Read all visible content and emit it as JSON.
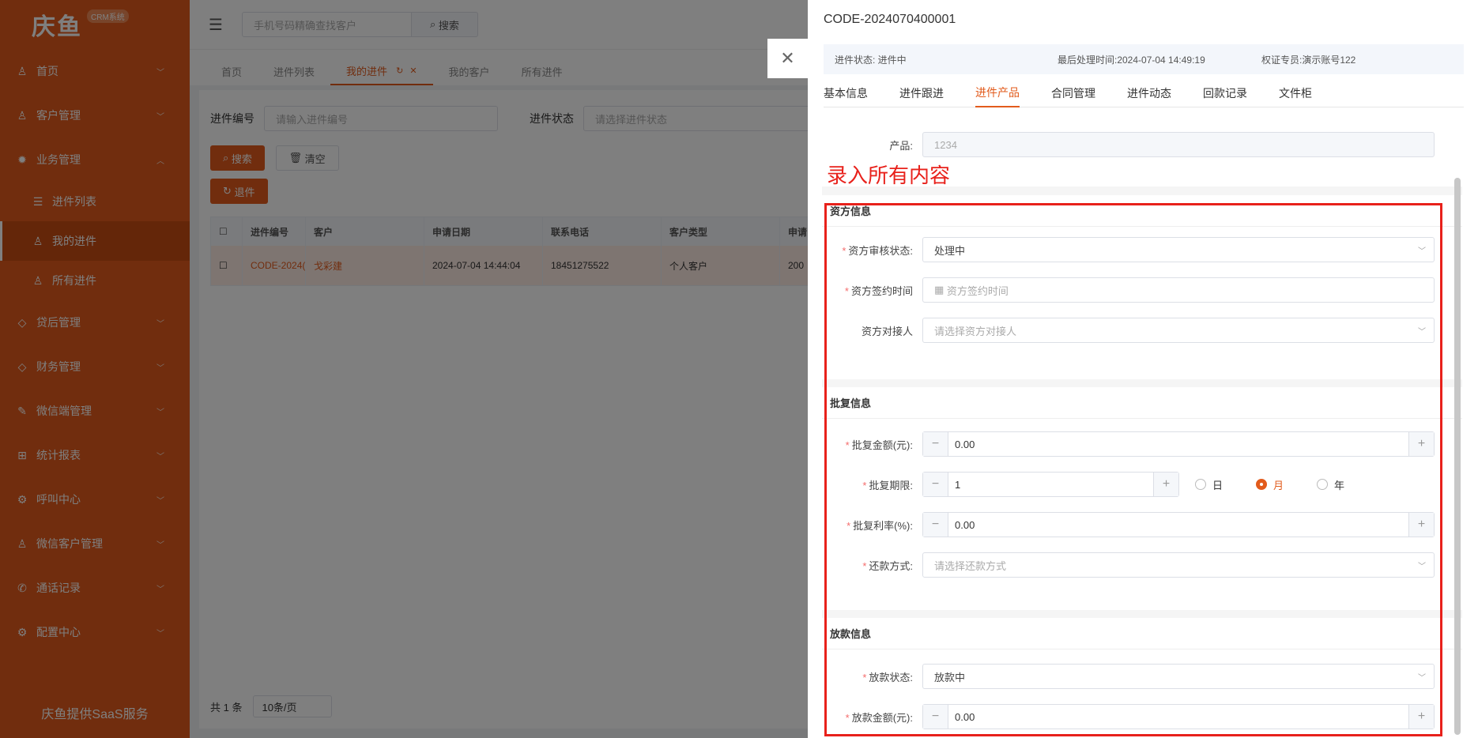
{
  "sidebar": {
    "logo": "庆鱼",
    "badge": "CRM系统",
    "items": [
      {
        "label": "首页",
        "icon": "user-icon"
      },
      {
        "label": "客户管理",
        "icon": "customer-icon"
      },
      {
        "label": "业务管理",
        "icon": "gear-icon"
      },
      {
        "label": "贷后管理",
        "icon": "tag-icon"
      },
      {
        "label": "财务管理",
        "icon": "tag-icon"
      },
      {
        "label": "微信端管理",
        "icon": "edit-icon"
      },
      {
        "label": "统计报表",
        "icon": "table-icon"
      },
      {
        "label": "呼叫中心",
        "icon": "settings-icon"
      },
      {
        "label": "微信客户管理",
        "icon": "customer-icon"
      },
      {
        "label": "通话记录",
        "icon": "phone-icon"
      },
      {
        "label": "配置中心",
        "icon": "settings-icon"
      }
    ],
    "sub_items": [
      {
        "label": "进件列表"
      },
      {
        "label": "我的进件"
      },
      {
        "label": "所有进件"
      }
    ],
    "footer": "庆鱼提供SaaS服务"
  },
  "topbar": {
    "search_placeholder": "手机号码精确查找客户",
    "search_button": "搜索"
  },
  "tabs": [
    "首页",
    "进件列表",
    "我的进件",
    "我的客户",
    "所有进件"
  ],
  "filter": {
    "code_label": "进件编号",
    "code_placeholder": "请输入进件编号",
    "status_label": "进件状态",
    "status_placeholder": "请选择进件状态",
    "search": "搜索",
    "clear": "清空",
    "withdraw": "退件"
  },
  "table": {
    "headers": [
      "进件编号",
      "客户",
      "申请日期",
      "联系电话",
      "客户类型",
      "申请"
    ],
    "rows": [
      [
        "CODE-2024(",
        "戈彩建",
        "2024-07-04 14:44:04",
        "18451275522",
        "个人客户",
        "200"
      ]
    ]
  },
  "pager": {
    "total": "共 1 条",
    "size": "10条/页"
  },
  "drawer": {
    "title": "CODE-2024070400001",
    "info": {
      "status": "进件状态: 进件中",
      "last_time": "最后处理时间:2024-07-04 14:49:19",
      "owner": "权证专员:演示账号122"
    },
    "tabs": [
      "基本信息",
      "进件跟进",
      "进件产品",
      "合同管理",
      "进件动态",
      "回款记录",
      "文件柜"
    ],
    "product_label": "产品:",
    "product_value": "1234",
    "annotation": "录入所有内容",
    "funder": {
      "title": "资方信息",
      "review_label": "资方审核状态:",
      "review_value": "处理中",
      "sign_label": "资方签约时间",
      "sign_placeholder": "资方签约时间",
      "contact_label": "资方对接人",
      "contact_placeholder": "请选择资方对接人"
    },
    "approval": {
      "title": "批复信息",
      "amount_label": "批复金额(元):",
      "amount_value": "0.00",
      "term_label": "批复期限:",
      "term_value": "1",
      "units": [
        "日",
        "月",
        "年"
      ],
      "selected_unit": "月",
      "rate_label": "批复利率(%):",
      "rate_value": "0.00",
      "repay_label": "还款方式:",
      "repay_placeholder": "请选择还款方式"
    },
    "loan": {
      "title": "放款信息",
      "status_label": "放款状态:",
      "status_value": "放款中",
      "amount_label": "放款金额(元):",
      "amount_value": "0.00"
    }
  },
  "colors": {
    "accent": "#e25b1c",
    "annotation": "#e8211b"
  }
}
